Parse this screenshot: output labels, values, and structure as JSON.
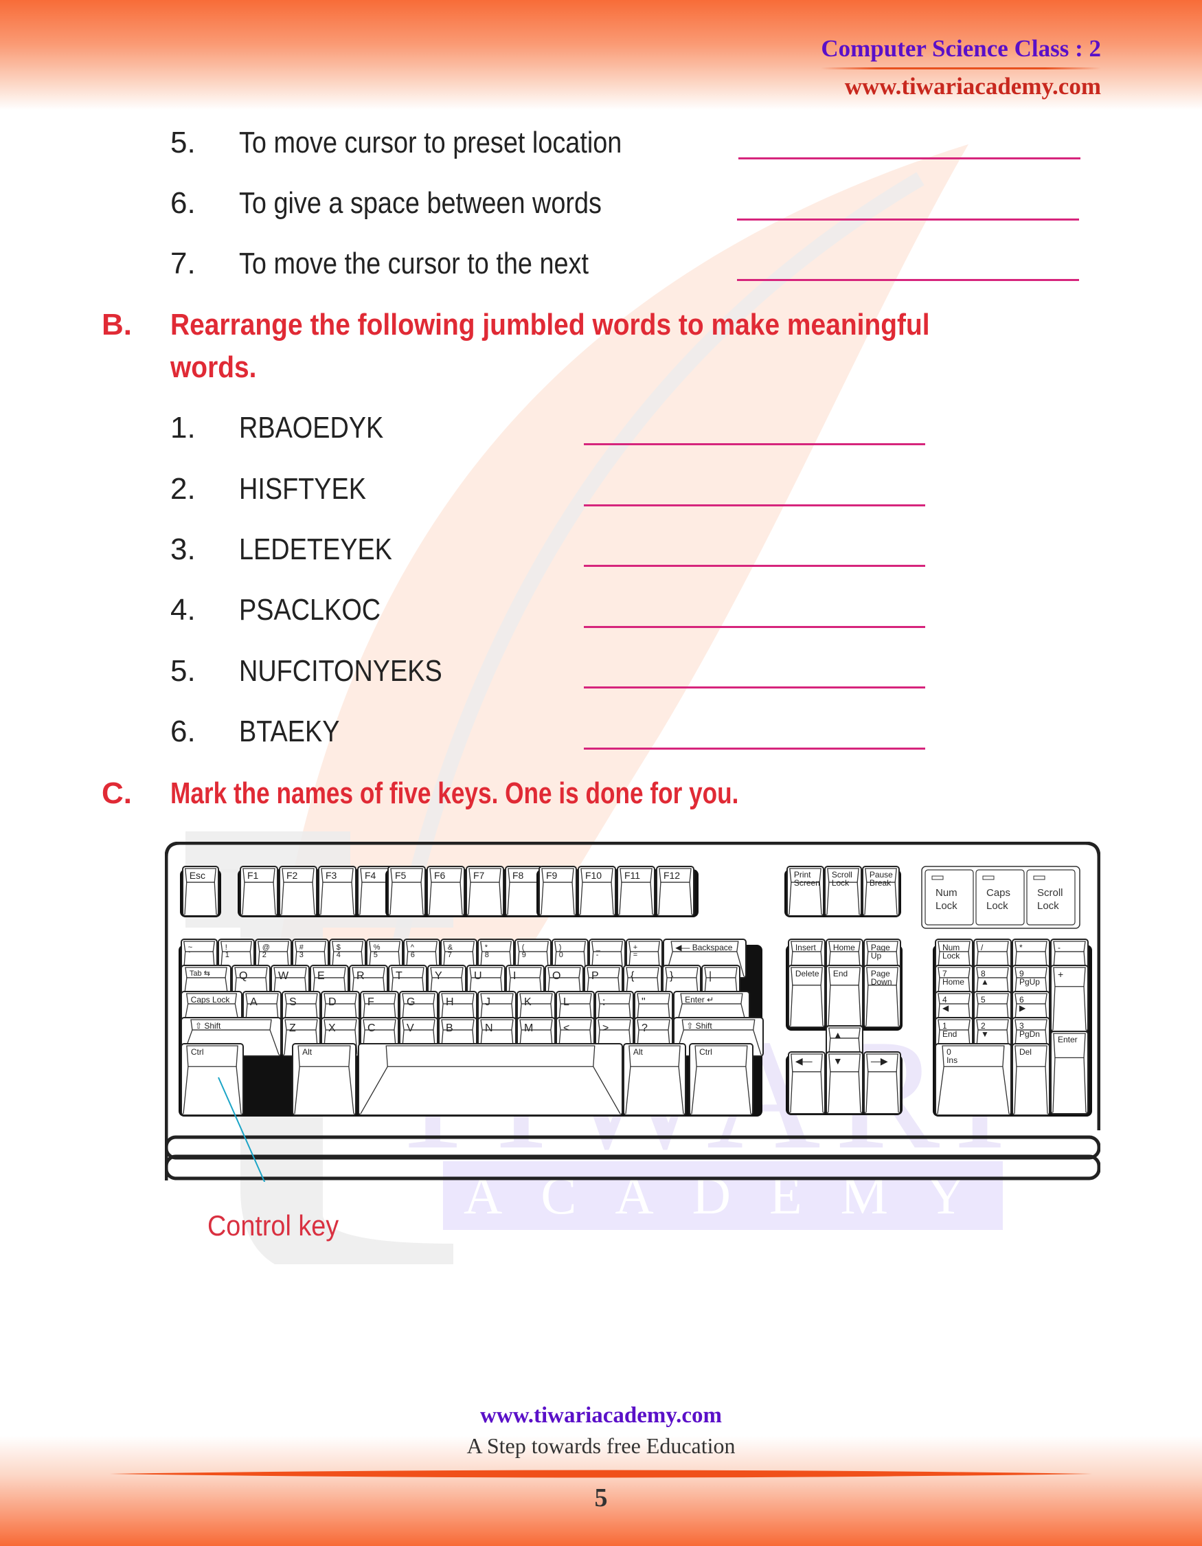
{
  "header": {
    "title": "Computer Science Class : 2",
    "url": "www.tiwariacademy.com"
  },
  "section_a_items": [
    {
      "num": "5.",
      "text": "To move cursor to preset location"
    },
    {
      "num": "6.",
      "text": "To give a space between words"
    },
    {
      "num": "7.",
      "text": "To move the cursor to the next"
    }
  ],
  "section_b": {
    "letter": "B.",
    "heading_line1": "Rearrange the following jumbled words to make meaningful",
    "heading_line2": "words.",
    "items": [
      {
        "num": "1.",
        "word": "RBAOEDYK"
      },
      {
        "num": "2.",
        "word": "HISFTYEK"
      },
      {
        "num": "3.",
        "word": "LEDETEYEK"
      },
      {
        "num": "4.",
        "word": "PSACLKOC"
      },
      {
        "num": "5.",
        "word": "NUFCITONYEKS"
      },
      {
        "num": "6.",
        "word": "BTAEKY"
      }
    ]
  },
  "section_c": {
    "letter": "C.",
    "heading": "Mark the names of five keys. One is done for you.",
    "caption": "Control key"
  },
  "keyboard": {
    "esc": "Esc",
    "fkeys": [
      "F1",
      "F2",
      "F3",
      "F4",
      "F5",
      "F6",
      "F7",
      "F8",
      "F9",
      "F10",
      "F11",
      "F12"
    ],
    "sys_keys": [
      [
        "Print",
        "Screen"
      ],
      [
        "Scroll",
        "Lock"
      ],
      [
        "Pause",
        "Break"
      ]
    ],
    "indicators": [
      [
        "Num",
        "Lock"
      ],
      [
        "Caps",
        "Lock"
      ],
      [
        "Scroll",
        "Lock"
      ]
    ],
    "number_row": [
      [
        "~",
        "`"
      ],
      [
        "!",
        "1"
      ],
      [
        "@",
        "2"
      ],
      [
        "#",
        "3"
      ],
      [
        "$",
        "4"
      ],
      [
        "%",
        "5"
      ],
      [
        "^",
        "6"
      ],
      [
        "&",
        "7"
      ],
      [
        "*",
        "8"
      ],
      [
        "(",
        "9"
      ],
      [
        ")",
        "0"
      ],
      [
        "_",
        "-"
      ],
      [
        "+",
        "="
      ]
    ],
    "backspace": "Backspace",
    "tab": "Tab",
    "qrow": [
      "Q",
      "W",
      "E",
      "R",
      "T",
      "Y",
      "U",
      "I",
      "O",
      "P",
      "{",
      "}",
      "|"
    ],
    "caps": "Caps Lock",
    "arow": [
      "A",
      "S",
      "D",
      "F",
      "G",
      "H",
      "J",
      "K",
      "L",
      ":",
      "\""
    ],
    "enter": "Enter",
    "shift": "Shift",
    "zrow": [
      "Z",
      "X",
      "C",
      "V",
      "B",
      "N",
      "M",
      "<",
      ">",
      "?"
    ],
    "ctrl": "Ctrl",
    "alt": "Alt",
    "nav_top": [
      "Insert",
      "Home",
      "Page Up"
    ],
    "nav_bottom": [
      "Delete",
      "End",
      "Page Down"
    ],
    "numpad_top": [
      "Num Lock",
      "/",
      "*",
      "-"
    ],
    "numpad_rows": [
      [
        "7 Home",
        "8 ▲",
        "9 PgUp"
      ],
      [
        "4 ◀",
        "5",
        "6 ▶"
      ],
      [
        "1 End",
        "2 ▼",
        "3 PgDn"
      ]
    ],
    "numpad_zero": "0 Ins",
    "numpad_del": "Del",
    "numpad_plus": "+",
    "numpad_enter": "Enter"
  },
  "watermark": {
    "main": "TIWARI",
    "sub": "ACADEMY"
  },
  "footer": {
    "url": "www.tiwariacademy.com",
    "tagline": "A Step towards free Education",
    "page_number": "5"
  }
}
